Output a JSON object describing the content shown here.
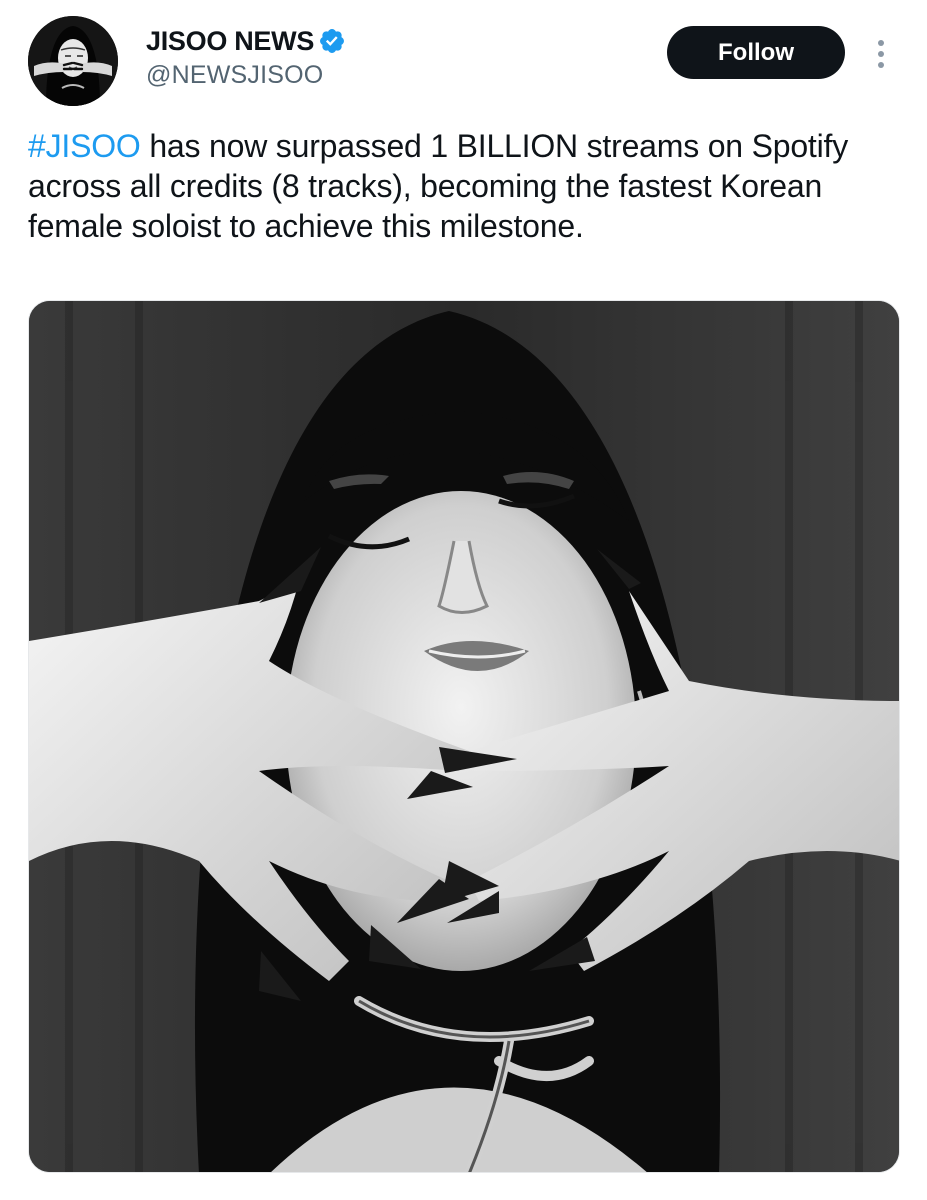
{
  "author": {
    "display_name": "JISOO NEWS",
    "handle": "@NEWSJISOO",
    "verified": true,
    "avatar_icon": "profile-photo"
  },
  "actions": {
    "follow_label": "Follow",
    "more_icon": "more-vertical-icon"
  },
  "tweet": {
    "hashtag": "#JISOO",
    "body": " has now surpassed 1 BILLION streams on Spotify across all credits (8 tracks), becoming the fastest Korean female soloist to achieve this milestone."
  },
  "media": {
    "type": "photo",
    "style": "black-and-white portrait"
  },
  "colors": {
    "accent": "#1d9bf0",
    "text": "#0f1419",
    "secondary_text": "#536471",
    "button_bg": "#0f1419",
    "button_text": "#ffffff"
  }
}
